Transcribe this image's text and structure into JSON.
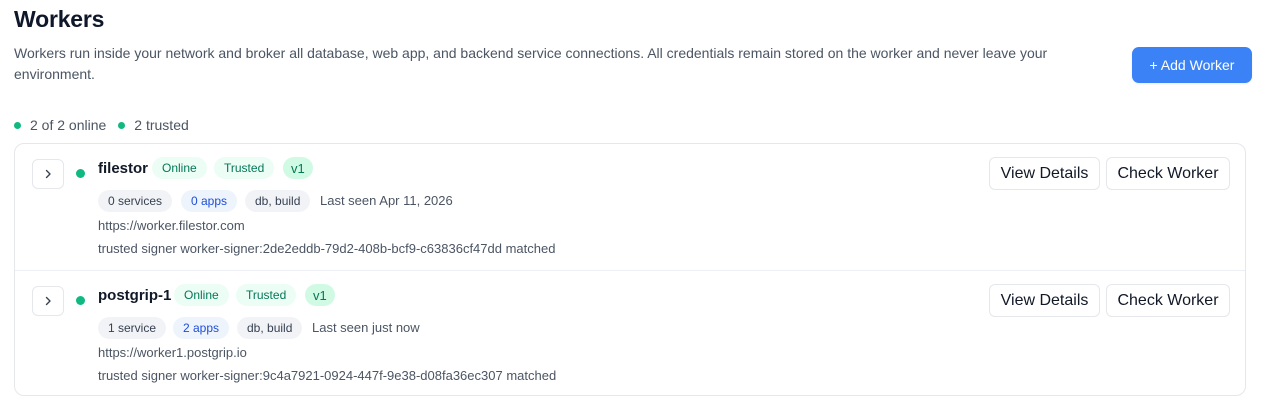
{
  "page": {
    "title": "Workers",
    "description": "Workers run inside your network and broker all database, web app, and backend service connections. All credentials remain stored on the worker and never leave your environment.",
    "add_button_label": "+ Add Worker"
  },
  "summary": {
    "online": "2 of 2 online",
    "trusted": "2 trusted"
  },
  "colors": {
    "accent": "#3b82f6",
    "online_green": "#10b981"
  },
  "workers": [
    {
      "name": "filestor",
      "status": "Online",
      "trust": "Trusted",
      "version": "v1",
      "services": "0 services",
      "apps": "0 apps",
      "tags": "db, build",
      "last_seen": "Last seen Apr 11, 2026",
      "url": "https://worker.filestor.com",
      "signer": "trusted signer worker-signer:2de2eddb-79d2-408b-bcf9-c63836cf47dd matched",
      "view_label": "View Details",
      "check_label": "Check Worker"
    },
    {
      "name": "postgrip-1",
      "status": "Online",
      "trust": "Trusted",
      "version": "v1",
      "services": "1 service",
      "apps": "2 apps",
      "tags": "db, build",
      "last_seen": "Last seen just now",
      "url": "https://worker1.postgrip.io",
      "signer": "trusted signer worker-signer:9c4a7921-0924-447f-9e38-d08fa36ec307 matched",
      "view_label": "View Details",
      "check_label": "Check Worker"
    }
  ]
}
